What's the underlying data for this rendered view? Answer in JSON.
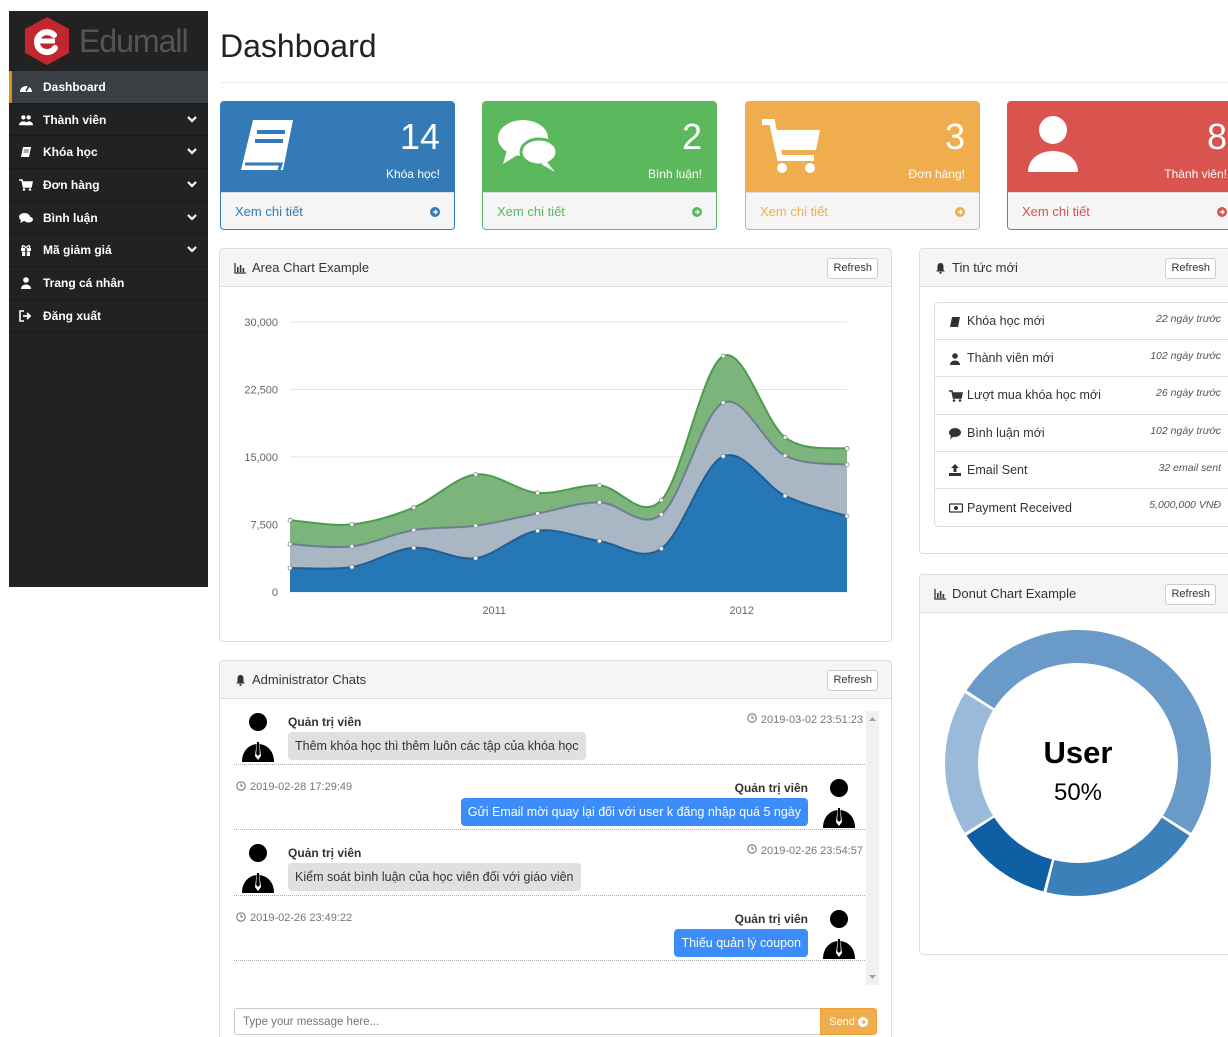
{
  "brand": {
    "name": "Edumall"
  },
  "sidebar": {
    "items": [
      {
        "label": "Dashboard",
        "icon": "dashboard-icon",
        "active": true,
        "has_submenu": false
      },
      {
        "label": "Thành viên",
        "icon": "users-icon",
        "active": false,
        "has_submenu": true
      },
      {
        "label": "Khóa học",
        "icon": "book-icon",
        "active": false,
        "has_submenu": true
      },
      {
        "label": "Đơn hàng",
        "icon": "cart-icon",
        "active": false,
        "has_submenu": true
      },
      {
        "label": "Bình luận",
        "icon": "comments-icon",
        "active": false,
        "has_submenu": true
      },
      {
        "label": "Mã giảm giá",
        "icon": "gift-icon",
        "active": false,
        "has_submenu": true
      },
      {
        "label": "Trang cá nhân",
        "icon": "user-icon",
        "active": false,
        "has_submenu": false
      },
      {
        "label": "Đăng xuất",
        "icon": "sign-out-icon",
        "active": false,
        "has_submenu": false
      }
    ]
  },
  "header": {
    "title": "Dashboard"
  },
  "stats": [
    {
      "value": "14",
      "label": "Khóa học!",
      "link": "Xem chi tiết",
      "icon": "book-icon",
      "color": "#337ab7",
      "link_color": "#337ab7"
    },
    {
      "value": "2",
      "label": "Bình luận!",
      "link": "Xem chi tiết",
      "icon": "comments-icon",
      "color": "#5cb85c",
      "link_color": "#5cb85c"
    },
    {
      "value": "3",
      "label": "Đơn hàng!",
      "link": "Xem chi tiết",
      "icon": "cart-icon",
      "color": "#f0ad4e",
      "link_color": "#f0ad4e"
    },
    {
      "value": "8",
      "label": "Thành viên!",
      "link": "Xem chi tiết",
      "icon": "user-icon",
      "color": "#d9534f",
      "link_color": "#d9534f"
    }
  ],
  "area_panel": {
    "title": "Area Chart Example",
    "refresh": "Refresh"
  },
  "news_panel": {
    "title": "Tin tức mới",
    "refresh": "Refresh",
    "items": [
      {
        "label": "Khóa học mới",
        "time": "22 ngày trước",
        "icon": "book-icon"
      },
      {
        "label": "Thành viên mới",
        "time": "102 ngày trước",
        "icon": "user-icon"
      },
      {
        "label": "Lượt mua khóa học mới",
        "time": "26 ngày trước",
        "icon": "cart-icon"
      },
      {
        "label": "Bình luận mới",
        "time": "102 ngày trước",
        "icon": "comment-icon"
      },
      {
        "label": "Email Sent",
        "time": "32 email sent",
        "icon": "upload-icon"
      },
      {
        "label": "Payment Received",
        "time": "5,000,000 VNĐ",
        "icon": "money-icon"
      }
    ]
  },
  "donut_panel": {
    "title": "Donut Chart Example",
    "refresh": "Refresh",
    "center_label": "User",
    "center_value": "50%"
  },
  "chat_panel": {
    "title": "Administrator Chats",
    "refresh": "Refresh",
    "messages": [
      {
        "side": "left",
        "name": "Quản trị viên",
        "time": "2019-03-02 23:51:23",
        "text": "Thêm khóa học thì thêm luôn các tập của khóa học"
      },
      {
        "side": "right",
        "name": "Quản trị viên",
        "time": "2019-02-28 17:29:49",
        "text": "Gửi Email mời quay lại đối với user k đăng nhập quá 5 ngày"
      },
      {
        "side": "left",
        "name": "Quản trị viên",
        "time": "2019-02-26 23:54:57",
        "text": "Kiểm soát bình luận của học viên đối với giáo viên"
      },
      {
        "side": "right",
        "name": "Quản trị viên",
        "time": "2019-02-26 23:49:22",
        "text": "Thiếu quản lý coupon"
      }
    ],
    "input_placeholder": "Type your message here...",
    "send_label": "Send"
  },
  "chart_data": [
    {
      "type": "area",
      "x_ticks": [
        "2011",
        "2012"
      ],
      "ylim": [
        0,
        30000
      ],
      "y_ticks": [
        "0",
        "7,500",
        "15,000",
        "22,500",
        "30,000"
      ],
      "grid": true,
      "stacked": true,
      "series": [
        {
          "values": [
            2666,
            2778,
            4912,
            3767,
            6810,
            5670,
            4820,
            15073,
            10687,
            8432
          ],
          "color": "#2577b5"
        },
        {
          "values": [
            2647,
            2294,
            1969,
            3597,
            1914,
            4293,
            3795,
            5967,
            4460,
            5713
          ],
          "color": "#a9b7c4"
        },
        {
          "values": [
            2666,
            2441,
            2501,
            5689,
            2293,
            1881,
            1588,
            5175,
            2028,
            1791
          ],
          "color": "#7cb47c"
        }
      ]
    },
    {
      "type": "pie",
      "donut": true,
      "center_label": "User",
      "center_value": "50%",
      "values": [
        50,
        20,
        12,
        18
      ],
      "colors": [
        "#6a9ac8",
        "#3b80b9",
        "#0e5fa3",
        "#99bbd9"
      ]
    }
  ]
}
